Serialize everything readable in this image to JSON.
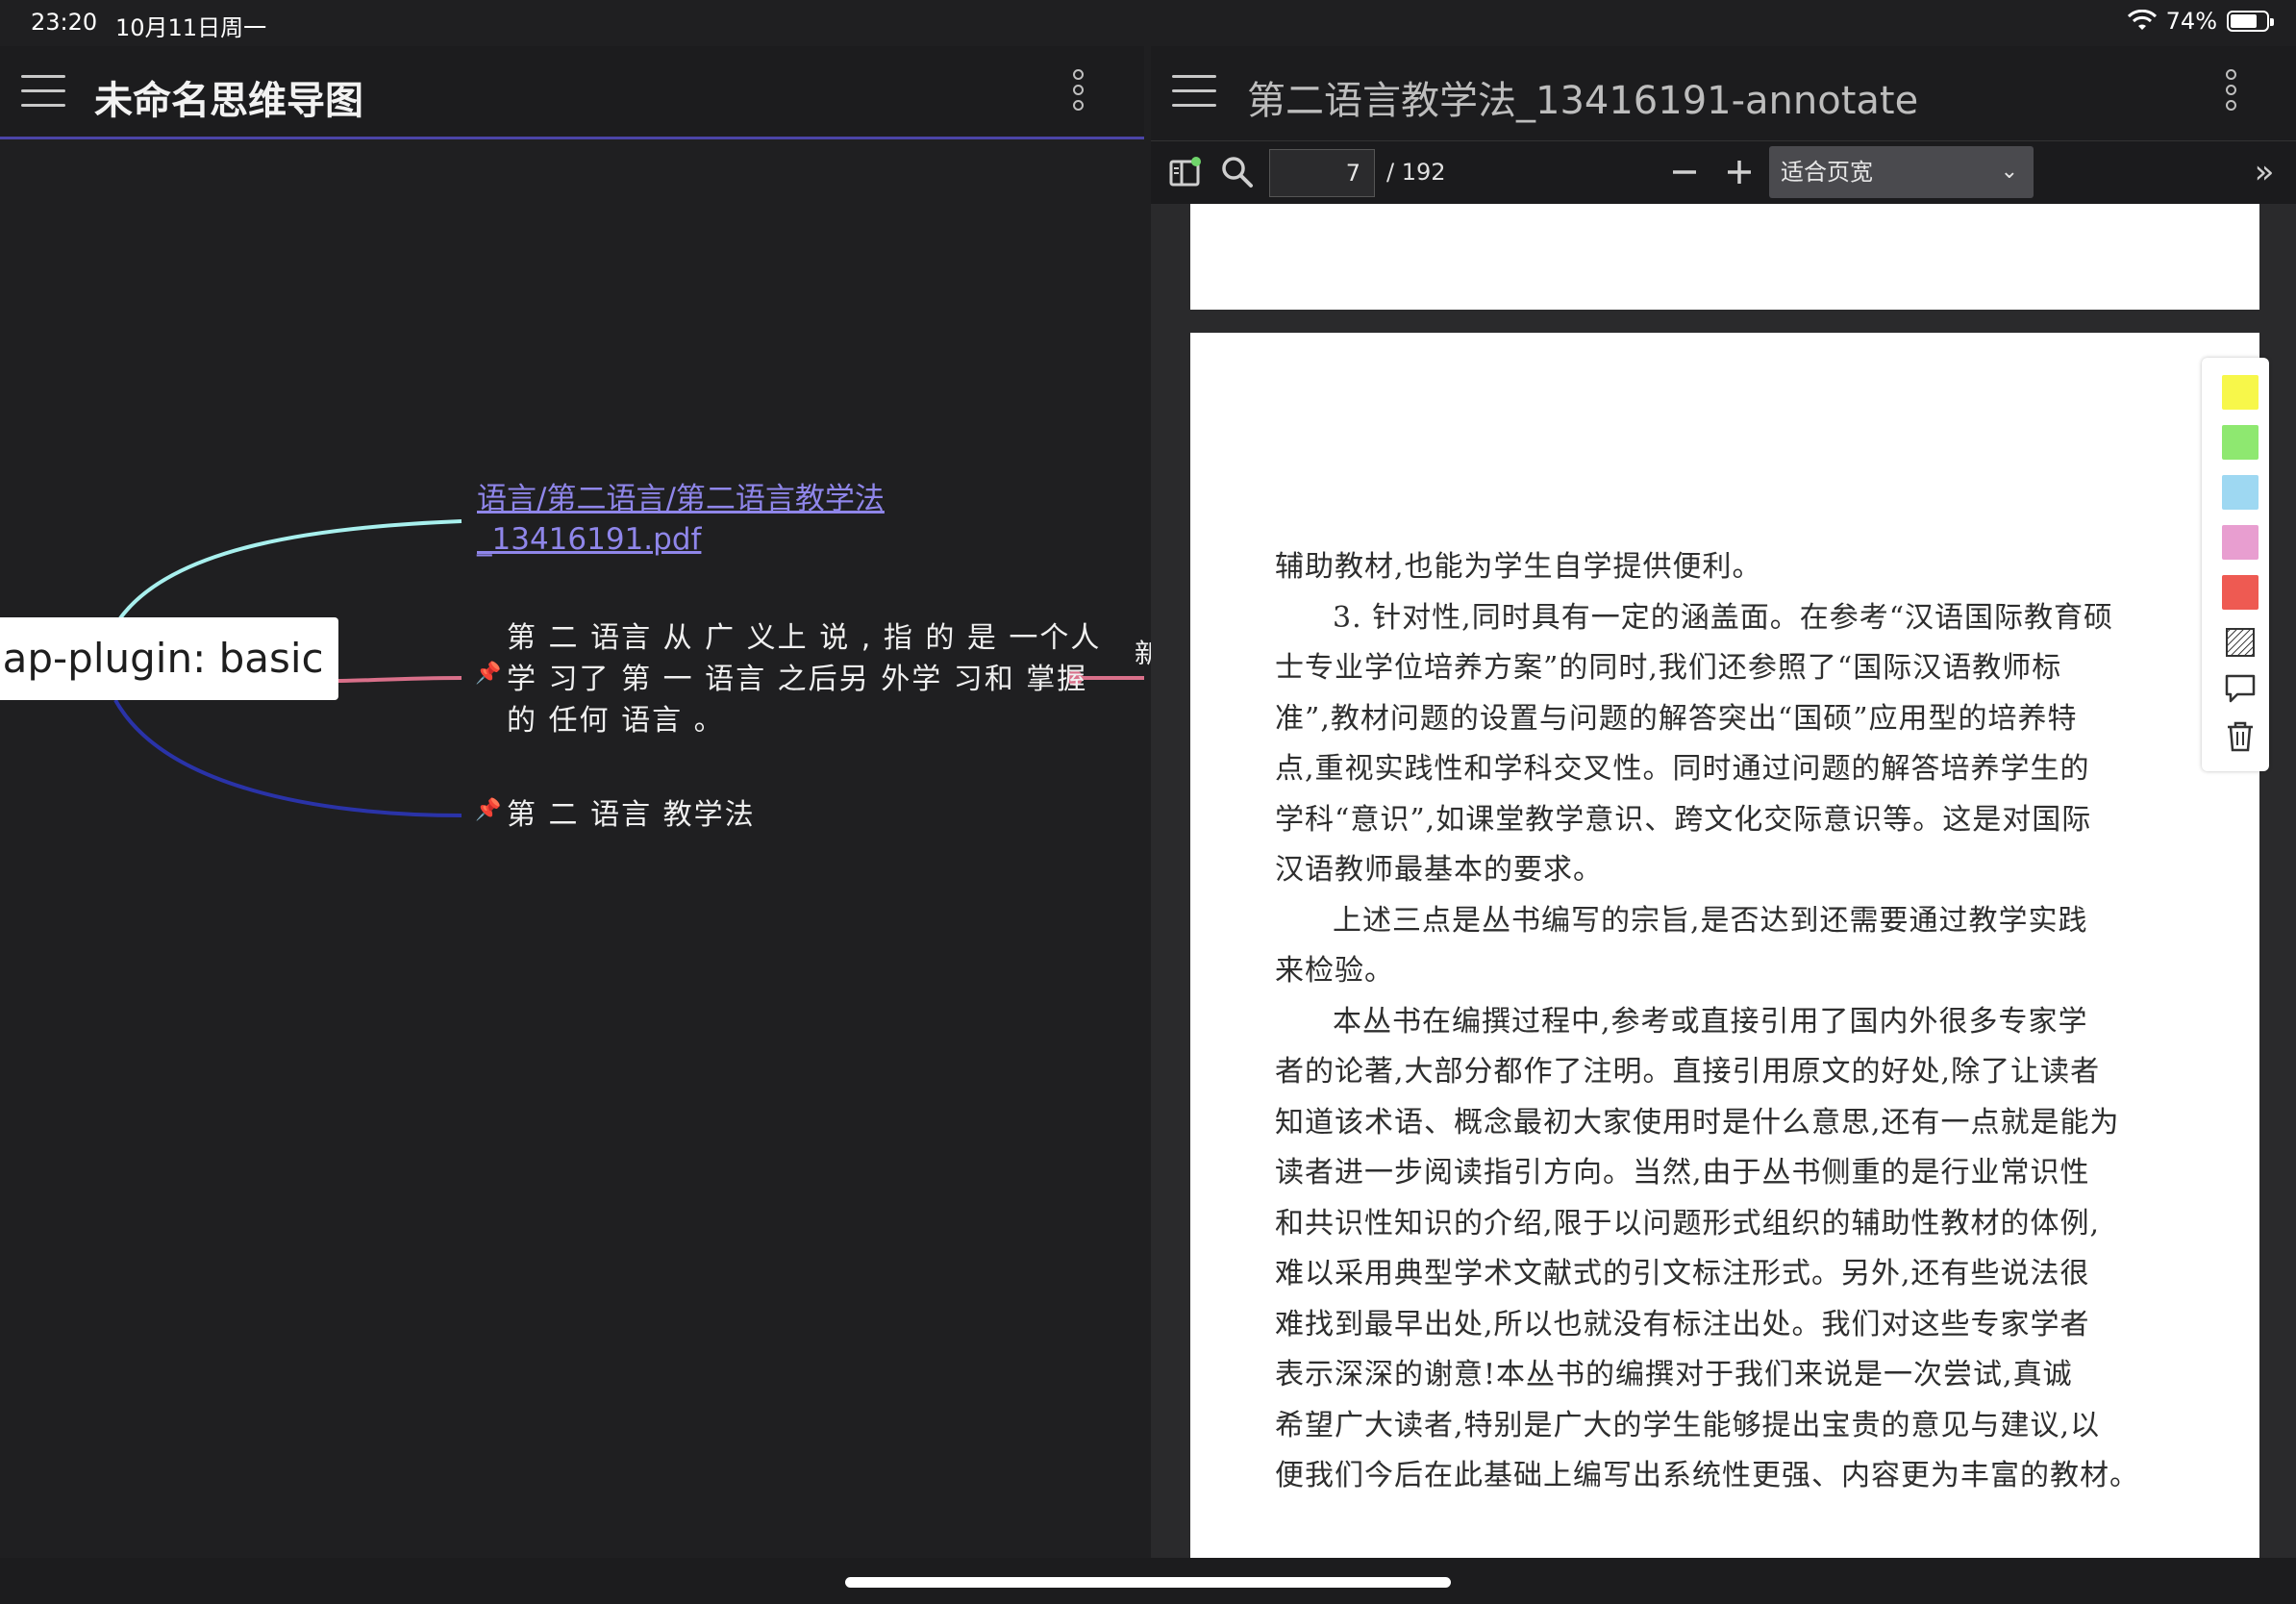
{
  "status_bar": {
    "time": "23:20",
    "date": "10月11日周一",
    "battery": "74%",
    "battery_level": 0.74
  },
  "left_pane": {
    "title": "未命名思维导图",
    "root_node": "nap-plugin: basic",
    "link_node": {
      "line1": "语言/第二语言/第二语言教学法",
      "line2": "_13416191.pdf"
    },
    "text_node": {
      "line1": "第 二 语言 从 广 义上 说 , 指 的 是 一个人",
      "line2": "学 习了 第 一 语言 之后另 外学 习和 掌握",
      "line3": "的 任何 语言 。"
    },
    "text_node_2": "第 二 语言 教学法",
    "edge_glyph": "新",
    "colors": {
      "edge_top": "#a8f0ee",
      "edge_mid": "#d9708a",
      "edge_bottom": "#2a33a8",
      "link": "#8f86ea",
      "header_line": "#4b44a8"
    }
  },
  "right_pane": {
    "title": "第二语言教学法_13416191-annotate",
    "toolbar": {
      "page_current": "7",
      "page_total": "/ 192",
      "zoom": "适合页宽"
    },
    "page_lines": [
      "辅助教材,也能为学生自学提供便利。",
      "3. 针对性,同时具有一定的涵盖面。在参考“汉语国际教育硕",
      "士专业学位培养方案”的同时,我们还参照了“国际汉语教师标",
      "准”,教材问题的设置与问题的解答突出“国硕”应用型的培养特",
      "点,重视实践性和学科交叉性。同时通过问题的解答培养学生的",
      "学科“意识”,如课堂教学意识、跨文化交际意识等。这是对国际",
      "汉语教师最基本的要求。",
      "上述三点是丛书编写的宗旨,是否达到还需要通过教学实践",
      "来检验。",
      "本丛书在编撰过程中,参考或直接引用了国内外很多专家学",
      "者的论著,大部分都作了注明。直接引用原文的好处,除了让读者",
      "知道该术语、概念最初大家使用时是什么意思,还有一点就是能为",
      "读者进一步阅读指引方向。当然,由于丛书侧重的是行业常识性",
      "和共识性知识的介绍,限于以问题形式组织的辅助性教材的体例,",
      "难以采用典型学术文献式的引文标注形式。另外,还有些说法很",
      "难找到最早出处,所以也就没有标注出处。我们对这些专家学者",
      "表示深深的谢意!本丛书的编撰对于我们来说是一次尝试,真诚",
      "希望广大读者,特别是广大的学生能够提出宝贵的意见与建议,以",
      "便我们今后在此基础上编写出系统性更强、内容更为丰富的教材。"
    ],
    "highlight_colors": [
      "#f7f74a",
      "#8ee870",
      "#9ed8f2",
      "#e89ed0",
      "#ee5a52"
    ],
    "palette_icons": [
      "hatch-icon",
      "comment-icon",
      "trash-icon"
    ]
  }
}
